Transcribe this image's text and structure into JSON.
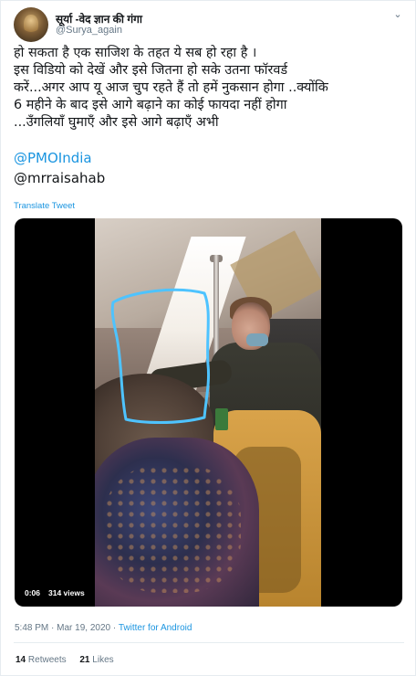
{
  "author": {
    "display_name": "सूर्या -वेद ज्ञान की गंगा",
    "handle": "@Surya_again",
    "avatar_icon": "avatar-image"
  },
  "menu": {
    "icon": "chevron-down-icon",
    "glyph": "⌄"
  },
  "tweet": {
    "lines": [
      "हो सकता है एक साजिश के तहत ये सब हो रहा है ।",
      "इस विडियो को देखें और इसे जितना हो सके उतना फॉरवर्ड",
      "करें...अगर आप यू आज चुप रहते हैं तो हमें नुकसान होगा ..क्योंकि",
      "6 महीने के बाद  इसे आगे बढ़ाने का कोई फायदा नहीं होगा",
      "...उँगलियाँ घुमाएँ और इसे आगे बढ़ाएँ अभी"
    ],
    "mentions": [
      "@PMOIndia",
      "@mrraisahab"
    ],
    "translate_label": "Translate Tweet"
  },
  "video": {
    "time": "0:06",
    "views": "314 views"
  },
  "meta": {
    "time": "5:48 PM",
    "separator": "·",
    "date": "Mar 19, 2020",
    "client": "Twitter for Android"
  },
  "stats": {
    "retweets_count": "14",
    "retweets_label": "Retweets",
    "likes_count": "21",
    "likes_label": "Likes"
  },
  "colors": {
    "link": "#1b95e0",
    "text": "#14171a",
    "secondary": "#657786",
    "annotation_circle": "#4ec3ff"
  }
}
